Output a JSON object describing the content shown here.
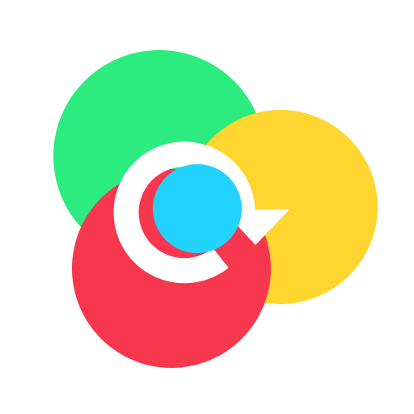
{
  "icon": {
    "name": "refresh-circles-logo",
    "colors": {
      "background": "#ffffff",
      "green": "#2CEC7F",
      "yellow": "#FFD52F",
      "red": "#F6374E",
      "center": "#22D3FF",
      "arrow": "#ffffff"
    }
  }
}
